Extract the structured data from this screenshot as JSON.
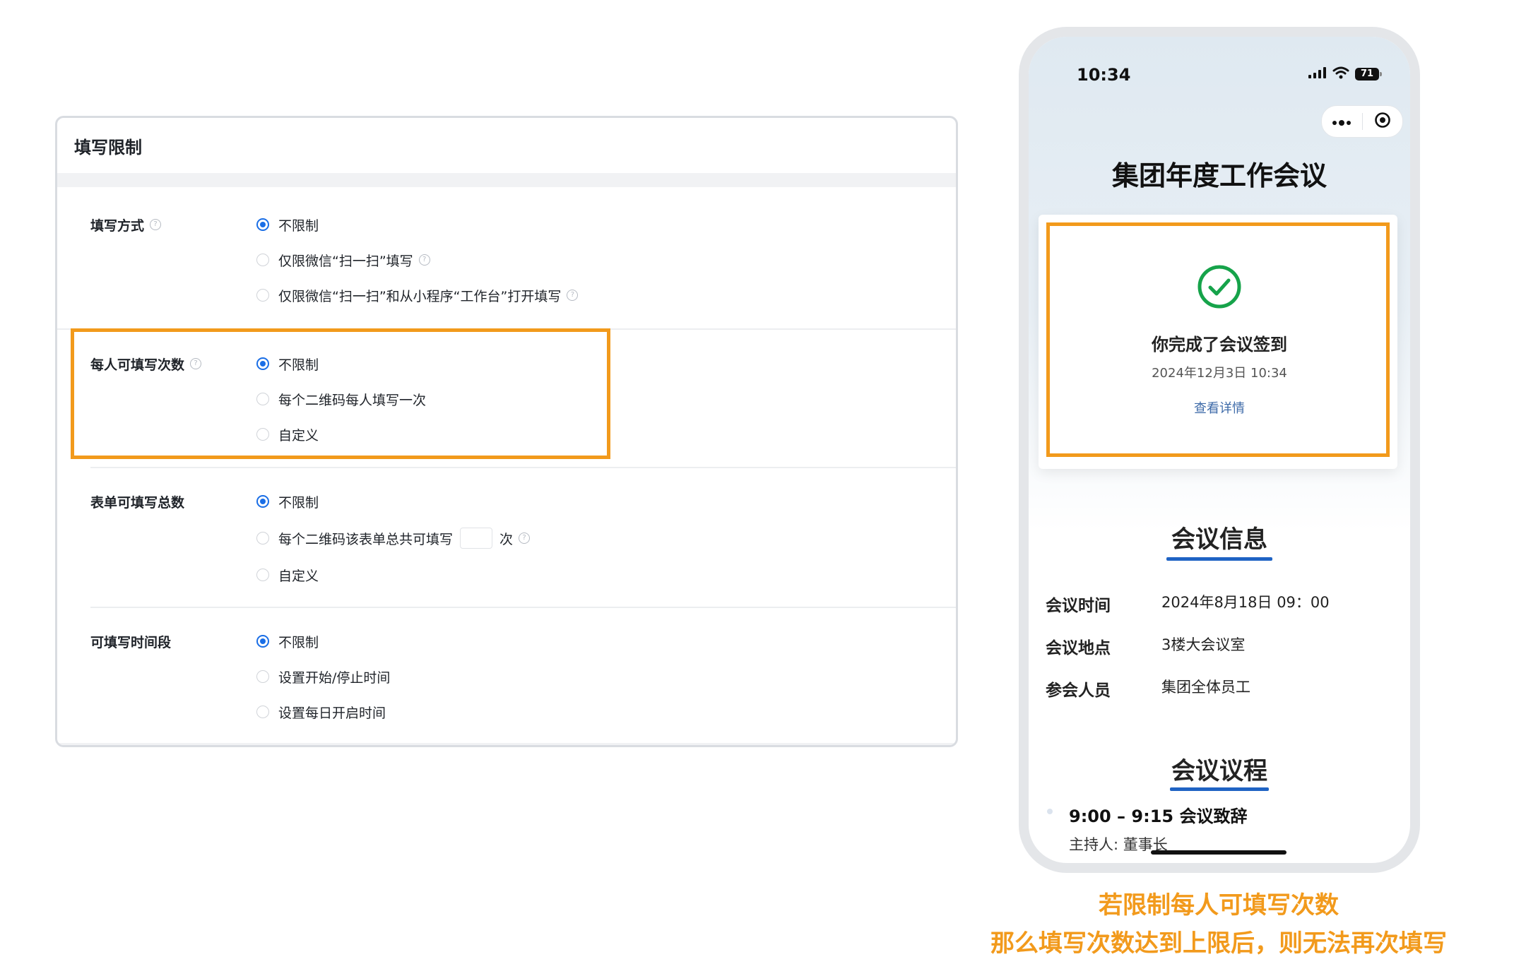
{
  "colors": {
    "accent_orange": "#f29a1c",
    "radio_blue": "#1a6ee6",
    "link_blue": "#3d6aa8",
    "success_green": "#16a34a"
  },
  "panel": {
    "title": "填写限制",
    "sections": [
      {
        "label": "填写方式",
        "has_help": true,
        "selected_index": 0,
        "options": [
          "不限制",
          "仅限微信“扫一扫”填写",
          "仅限微信“扫一扫”和从小程序“工作台”打开填写"
        ]
      },
      {
        "label": "每人可填写次数",
        "has_help": true,
        "selected_index": 0,
        "options": [
          "不限制",
          "每个二维码每人填写一次",
          "自定义"
        ]
      },
      {
        "label": "表单可填写总数",
        "has_help": false,
        "selected_index": 0,
        "options": [
          "不限制",
          "每个二维码该表单总共可填写",
          "自定义"
        ],
        "count_suffix": "次"
      },
      {
        "label": "可填写时间段",
        "has_help": false,
        "selected_index": 0,
        "options": [
          "不限制",
          "设置开始/停止时间",
          "设置每日开启时间"
        ]
      }
    ]
  },
  "phone": {
    "status": {
      "time": "10:34",
      "battery": "71",
      "icons": [
        "signal-icon",
        "wifi-icon",
        "battery-icon"
      ]
    },
    "capsule_icons": [
      "more-icon",
      "close-target-icon"
    ],
    "title": "集团年度工作会议",
    "result": {
      "icon": "check-circle-icon",
      "text": "你完成了会议签到",
      "time": "2024年12月3日 10:34",
      "link": "查看详情"
    },
    "info": {
      "title": "会议信息",
      "rows": [
        {
          "label": "会议时间",
          "value": "2024年8月18日 09：00"
        },
        {
          "label": "会议地点",
          "value": "3楼大会议室"
        },
        {
          "label": "参会人员",
          "value": "集团全体员工"
        }
      ]
    },
    "agenda": {
      "title": "会议议程",
      "items": [
        {
          "time": "9:00 – 9:15 会议致辞",
          "host": "主持人: 董事长"
        }
      ]
    }
  },
  "caption": {
    "line1": "若限制每人可填写次数",
    "line2": "那么填写次数达到上限后，则无法再次填写"
  }
}
